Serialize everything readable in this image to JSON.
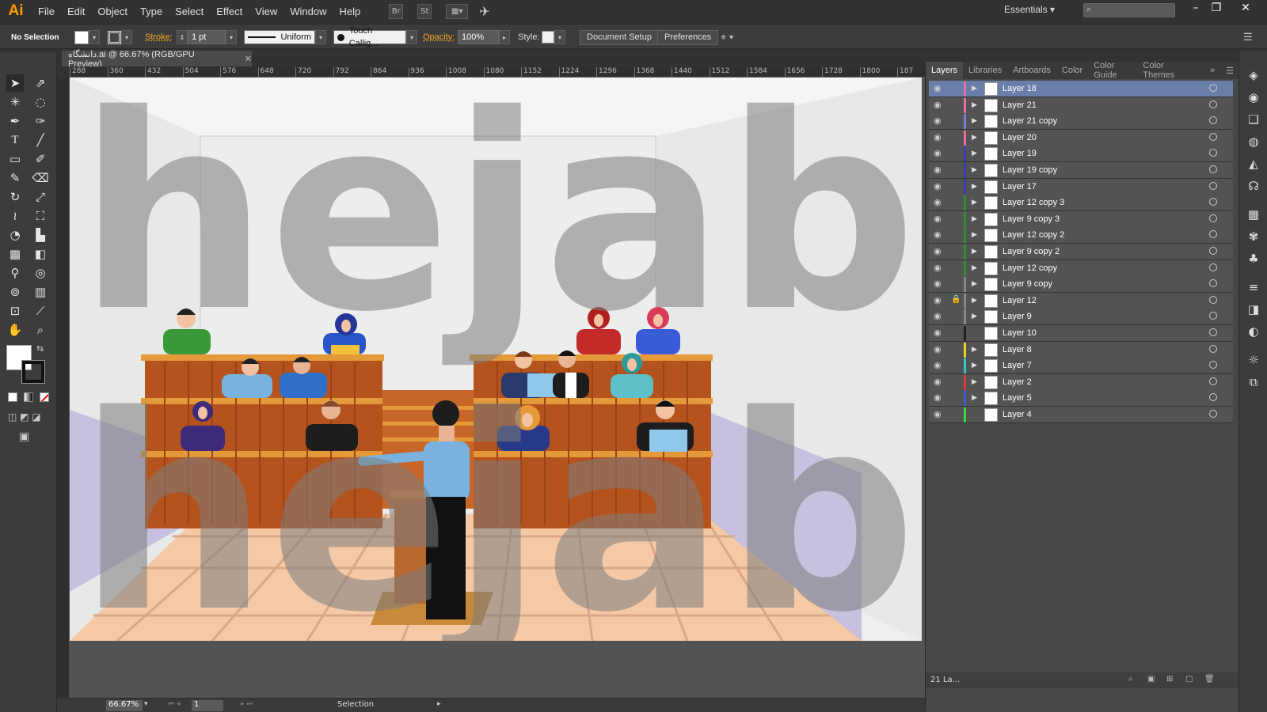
{
  "app": {
    "logo": "Ai"
  },
  "menu": [
    "File",
    "Edit",
    "Object",
    "Type",
    "Select",
    "Effect",
    "View",
    "Window",
    "Help"
  ],
  "menubar_buttons": {
    "br": "Br",
    "st": "St"
  },
  "workspace": "Essentials",
  "control": {
    "selection": "No Selection",
    "stroke_label": "Stroke:",
    "stroke_value": "1 pt",
    "profile": "Uniform",
    "brush": "Touch Callig...",
    "opacity_label": "Opacity:",
    "opacity_value": "100%",
    "style_label": "Style:",
    "document_setup": "Document Setup",
    "preferences": "Preferences"
  },
  "document": {
    "tab_title": "دانشگاه.ai @ 66.67% (RGB/GPU Preview)",
    "watermark": "hejab"
  },
  "ruler_ticks": [
    "288",
    "360",
    "432",
    "504",
    "576",
    "648",
    "720",
    "792",
    "864",
    "936",
    "1008",
    "1080",
    "1152",
    "1224",
    "1296",
    "1368",
    "1440",
    "1512",
    "1584",
    "1656",
    "1728",
    "1800",
    "187"
  ],
  "status": {
    "zoom": "66.67%",
    "artboard_num": "1",
    "tool": "Selection"
  },
  "panel": {
    "tabs": [
      "Layers",
      "Libraries",
      "Artboards",
      "Color",
      "Color Guide",
      "Color Themes"
    ],
    "layers": [
      {
        "name": "Layer 18",
        "color": "#e56ea9"
      },
      {
        "name": "Layer 21",
        "color": "#e56ea9"
      },
      {
        "name": "Layer 21 copy",
        "color": "#7b7bd8"
      },
      {
        "name": "Layer 20",
        "color": "#e56ea9"
      },
      {
        "name": "Layer 19",
        "color": "#3a3ab8"
      },
      {
        "name": "Layer 19 copy",
        "color": "#3a3ab8"
      },
      {
        "name": "Layer 17",
        "color": "#3a3ab8"
      },
      {
        "name": "Layer 12 copy 3",
        "color": "#2f8f2f"
      },
      {
        "name": "Layer 9 copy 3",
        "color": "#2f8f2f"
      },
      {
        "name": "Layer 12 copy 2",
        "color": "#2f8f2f"
      },
      {
        "name": "Layer 9 copy 2",
        "color": "#2f8f2f"
      },
      {
        "name": "Layer 12 copy",
        "color": "#2f8f2f"
      },
      {
        "name": "Layer 9 copy",
        "color": "#888888"
      },
      {
        "name": "Layer 12",
        "color": "#888888"
      },
      {
        "name": "Layer 9",
        "color": "#888888"
      },
      {
        "name": "Layer 10",
        "color": "#222222"
      },
      {
        "name": "Layer 8",
        "color": "#e8d32a"
      },
      {
        "name": "Layer 7",
        "color": "#34c8c8"
      },
      {
        "name": "Layer 2",
        "color": "#d83a3a"
      },
      {
        "name": "Layer 5",
        "color": "#3a5ad8"
      },
      {
        "name": "Layer 4",
        "color": "#3ad83a"
      }
    ],
    "footer": "21 La..."
  }
}
